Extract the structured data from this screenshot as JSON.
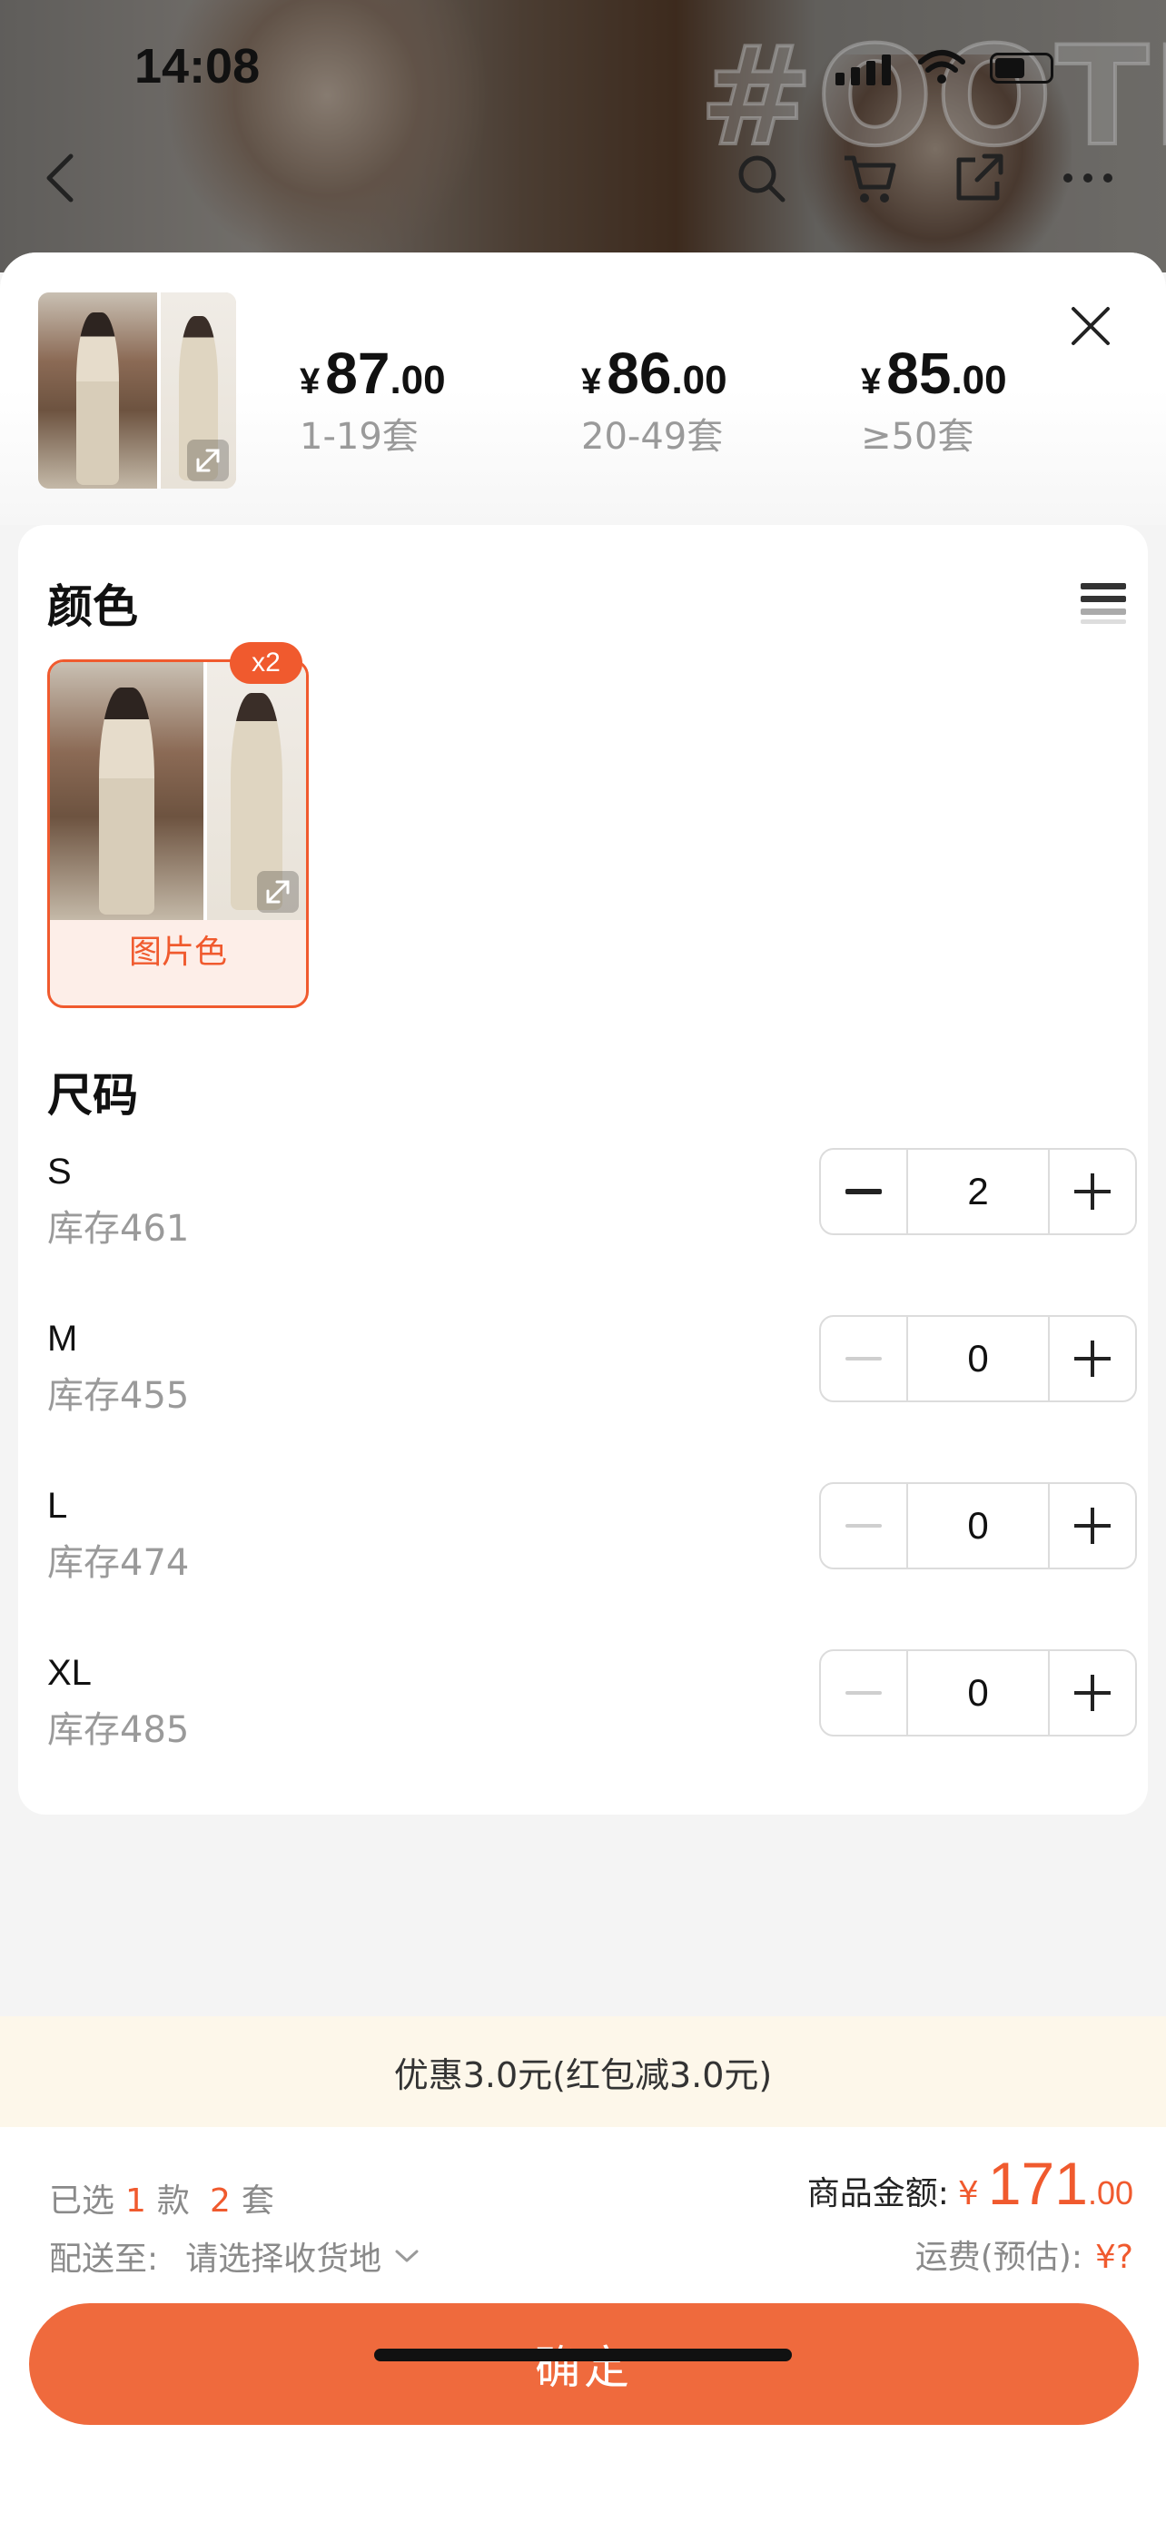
{
  "status_bar": {
    "time": "14:08"
  },
  "background": {
    "watermark": "#OOTD"
  },
  "header": {
    "price_tiers": [
      {
        "currency": "¥",
        "integer": "87",
        "decimal": ".00",
        "range": "1-19套"
      },
      {
        "currency": "¥",
        "integer": "86",
        "decimal": ".00",
        "range": "20-49套"
      },
      {
        "currency": "¥",
        "integer": "85",
        "decimal": ".00",
        "range": "≥50套"
      }
    ]
  },
  "color_section": {
    "title": "颜色",
    "options": [
      {
        "label": "图片色",
        "selected_count": "x2"
      }
    ]
  },
  "size_section": {
    "title": "尺码",
    "sizes": [
      {
        "name": "S",
        "stock": "库存461",
        "qty": "2"
      },
      {
        "name": "M",
        "stock": "库存455",
        "qty": "0"
      },
      {
        "name": "L",
        "stock": "库存474",
        "qty": "0"
      },
      {
        "name": "XL",
        "stock": "库存485",
        "qty": "0"
      }
    ]
  },
  "promo": {
    "text": "优惠3.0元(红包减3.0元)"
  },
  "footer": {
    "selected_prefix": "已选",
    "selected_styles": "1",
    "styles_unit": "款",
    "selected_sets": "2",
    "sets_unit": "套",
    "ship_label": "配送至:",
    "ship_placeholder": "请选择收货地",
    "amount_label": "商品金额:",
    "amount_currency": "¥",
    "amount_integer": "171",
    "amount_decimal": ".00",
    "freight_label": "运费(预估):",
    "freight_value": "¥?",
    "confirm_label": "确定"
  },
  "colors": {
    "accent": "#f05a2e",
    "button": "#ef6a3d",
    "promo_bg": "#fdf7ea"
  }
}
